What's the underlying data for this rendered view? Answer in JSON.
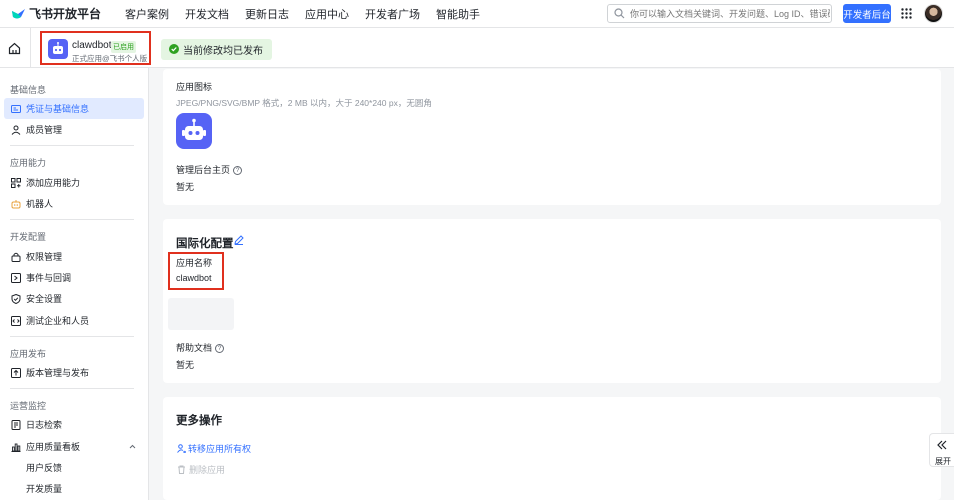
{
  "top_nav": {
    "brand": "飞书开放平台",
    "items": [
      "客户案例",
      "开发文档",
      "更新日志",
      "应用中心",
      "开发者广场",
      "智能助手"
    ],
    "search_placeholder": "你可以输入文档关键词、开发问题、Log ID、错误码",
    "dev_console_button": "开发者后台"
  },
  "app_header": {
    "app_name": "clawdbot",
    "status_tag": "已启用",
    "app_subtitle": "正式应用@飞书个人版",
    "publish_status": "当前修改均已发布"
  },
  "sidebar": {
    "groups": [
      {
        "title": "基础信息",
        "items": [
          {
            "label": "凭证与基础信息",
            "icon": "id-card-icon",
            "active": true
          },
          {
            "label": "成员管理",
            "icon": "member-icon"
          }
        ]
      },
      {
        "title": "应用能力",
        "items": [
          {
            "label": "添加应用能力",
            "icon": "grid-add-icon"
          },
          {
            "label": "机器人",
            "icon": "robot-icon"
          }
        ]
      },
      {
        "title": "开发配置",
        "items": [
          {
            "label": "权限管理",
            "icon": "lock-icon"
          },
          {
            "label": "事件与回调",
            "icon": "event-icon"
          },
          {
            "label": "安全设置",
            "icon": "shield-icon"
          },
          {
            "label": "测试企业和人员",
            "icon": "code-icon"
          }
        ]
      },
      {
        "title": "应用发布",
        "items": [
          {
            "label": "版本管理与发布",
            "icon": "upload-icon"
          }
        ]
      },
      {
        "title": "运营监控",
        "items": [
          {
            "label": "日志检索",
            "icon": "log-icon"
          },
          {
            "label": "应用质量看板",
            "icon": "chart-icon"
          },
          {
            "label": "用户反馈"
          },
          {
            "label": "开发质量"
          }
        ]
      }
    ]
  },
  "basic_card": {
    "icon_label": "应用图标",
    "icon_hint": "JPEG/PNG/SVG/BMP 格式，2 MB 以内，大于 240*240 px，无圆角",
    "homepage_label": "管理后台主页",
    "homepage_value": "暂无"
  },
  "i18n_card": {
    "title": "国际化配置",
    "name_label": "应用名称",
    "name_value": "clawdbot",
    "help_label": "帮助文档",
    "help_value": "暂无"
  },
  "more_card": {
    "title": "更多操作",
    "transfer_label": "转移应用所有权",
    "delete_label": "删除应用"
  },
  "expand_label": "展开",
  "colors": {
    "accent": "#3370ff",
    "robot_icon": "#5663f5",
    "highlight": "#e0301e",
    "success": "#2ea121"
  }
}
